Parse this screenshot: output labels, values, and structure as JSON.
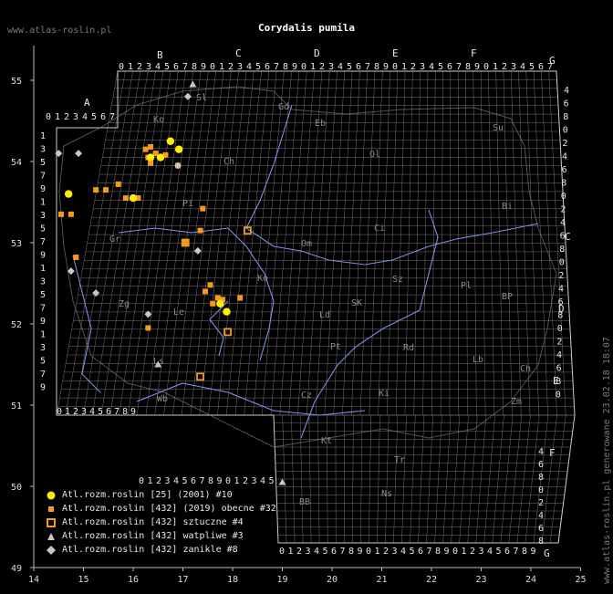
{
  "site_left": "www.atlas-roslin.pl",
  "title": "Corydalis pumila",
  "site_right": "www.atlas-roslin.pl generowane 23.02.18 18:07",
  "axes": {
    "lon_labels": [
      "14",
      "15",
      "16",
      "17",
      "18",
      "19",
      "20",
      "21",
      "22",
      "23",
      "24",
      "25"
    ],
    "lat_labels": [
      "49",
      "50",
      "51",
      "52",
      "53",
      "54",
      "55"
    ]
  },
  "zone_letters_top": [
    "A",
    "B",
    "C",
    "D",
    "E",
    "F",
    "G"
  ],
  "zone_letters_right": [
    "C",
    "D",
    "E",
    "F",
    "G"
  ],
  "grid_digits": "0123456789",
  "region_codes": [
    "Sl",
    "Gd",
    "Eb",
    "Su",
    "Ko",
    "Ol",
    "Ch",
    "Pi",
    "Bi",
    "Ci",
    "Gr",
    "Om",
    "Ko",
    "Sz",
    "Pl",
    "Zg",
    "Le",
    "Ld",
    "BP",
    "SK",
    "Pt",
    "Rd",
    "Lb",
    "Ch",
    "Ls",
    "Wb",
    "Cz",
    "Ki",
    "Zm",
    "Kt",
    "Tr",
    "Ns",
    "BB"
  ],
  "legend": [
    {
      "label": "Atl.rozm.roslin [25] (2001) #10",
      "symbol": "circle-yellow"
    },
    {
      "label": "Atl.rozm.roslin [432] (2019) obecne #32",
      "symbol": "square-orange"
    },
    {
      "label": "Atl.rozm.roslin [432] sztuczne #4",
      "symbol": "square-orange-hollow"
    },
    {
      "label": "Atl.rozm.roslin [432] watpliwe #3",
      "symbol": "triangle-gray"
    },
    {
      "label": "Atl.rozm.roslin [432] zanikle #8",
      "symbol": "diamond-gray"
    }
  ],
  "colors": {
    "circle": "#ffee00",
    "square": "#f59a1c",
    "gray": "#c8c8c8",
    "grid": "#9a9a9a",
    "river": "#7d8fe8"
  },
  "points": {
    "circle": [
      [
        16.75,
        54.25
      ],
      [
        16.92,
        54.15
      ],
      [
        16.35,
        54.05
      ],
      [
        16.55,
        54.05
      ],
      [
        14.7,
        53.6
      ],
      [
        16.0,
        53.55
      ],
      [
        17.75,
        52.25
      ],
      [
        17.88,
        52.15
      ]
    ],
    "square": [
      [
        16.25,
        54.15
      ],
      [
        16.35,
        54.18
      ],
      [
        16.45,
        54.1
      ],
      [
        16.3,
        54.05
      ],
      [
        16.35,
        53.98
      ],
      [
        16.65,
        54.08
      ],
      [
        16.9,
        53.95
      ],
      [
        15.7,
        53.72
      ],
      [
        15.45,
        53.65
      ],
      [
        15.25,
        53.65
      ],
      [
        15.85,
        53.55
      ],
      [
        16.1,
        53.55
      ],
      [
        14.75,
        53.35
      ],
      [
        14.55,
        53.35
      ],
      [
        17.05,
        53.0
      ],
      [
        17.35,
        53.15
      ],
      [
        14.85,
        52.82
      ],
      [
        17.4,
        53.42
      ],
      [
        17.55,
        52.48
      ],
      [
        17.45,
        52.4
      ],
      [
        17.7,
        52.32
      ],
      [
        18.15,
        52.32
      ],
      [
        16.3,
        51.95
      ],
      [
        17.8,
        52.3
      ],
      [
        17.6,
        52.25
      ]
    ],
    "square_hollow": [
      [
        17.05,
        53.0
      ],
      [
        18.3,
        53.15
      ],
      [
        17.9,
        51.9
      ],
      [
        17.35,
        51.35
      ]
    ],
    "triangle": [
      [
        17.2,
        54.95
      ],
      [
        16.5,
        51.5
      ],
      [
        19.0,
        50.05
      ]
    ],
    "diamond": [
      [
        17.1,
        54.8
      ],
      [
        14.5,
        54.1
      ],
      [
        14.9,
        54.1
      ],
      [
        16.9,
        53.95
      ],
      [
        17.3,
        52.9
      ],
      [
        14.75,
        52.65
      ],
      [
        15.25,
        52.38
      ],
      [
        16.3,
        52.12
      ]
    ]
  }
}
